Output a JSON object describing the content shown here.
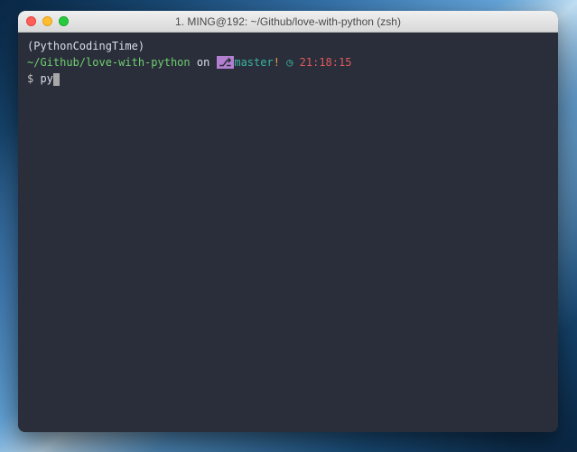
{
  "window": {
    "title": "1. MING@192: ~/Github/love-with-python (zsh)"
  },
  "terminal": {
    "context_line": "(PythonCodingTime)",
    "prompt": {
      "path": "~/Github/love-with-python",
      "on_word": " on ",
      "branch_icon": "⎇",
      "branch_name": "master",
      "branch_dirty": "!",
      "clock_icon": "◷",
      "time": "21:18:15"
    },
    "input": {
      "symbol": "$ ",
      "typed": "py"
    }
  }
}
